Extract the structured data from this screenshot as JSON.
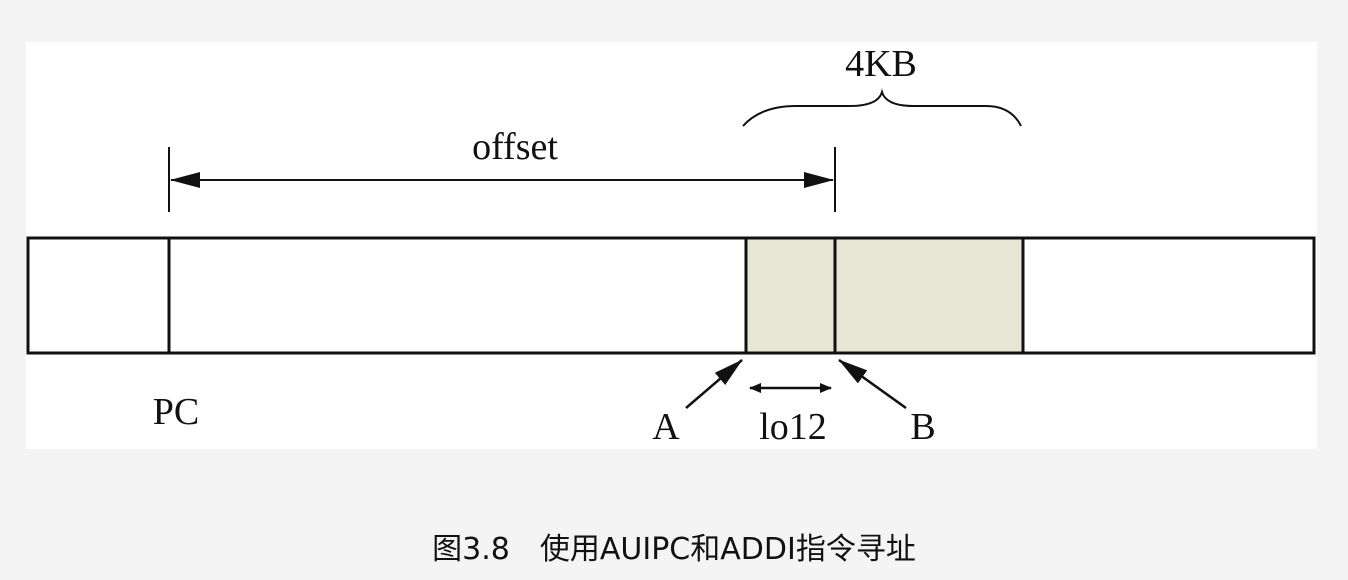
{
  "diagram": {
    "labels": {
      "size_label": "4KB",
      "offset_label": "offset",
      "pc_label": "PC",
      "a_label": "A",
      "lo12_label": "lo12",
      "b_label": "B"
    },
    "colors": {
      "highlight_fill": "#e6e6d4",
      "stroke": "#111111",
      "background": "#ffffff"
    }
  },
  "caption": "图3.8　使用AUIPC和ADDI指令寻址"
}
